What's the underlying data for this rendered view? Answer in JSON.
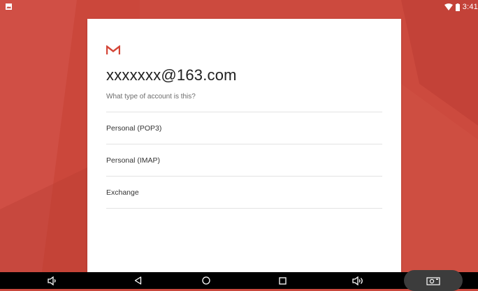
{
  "status_bar": {
    "time": "3:41",
    "left_icon": "image-notification-icon",
    "wifi_icon": "wifi-icon",
    "battery_icon": "battery-icon"
  },
  "card": {
    "logo": "gmail-logo",
    "email": "xxxxxxx@163.com",
    "subtitle": "What type of account is this?",
    "options": [
      {
        "label": "Personal (POP3)"
      },
      {
        "label": "Personal (IMAP)"
      },
      {
        "label": "Exchange"
      }
    ]
  },
  "nav_bar": {
    "buttons": [
      {
        "name": "volume-down-icon"
      },
      {
        "name": "back-icon"
      },
      {
        "name": "home-icon"
      },
      {
        "name": "recents-icon"
      },
      {
        "name": "volume-up-icon"
      },
      {
        "name": "screenshot-icon"
      }
    ]
  },
  "colors": {
    "background": "#cc4a3e",
    "card": "#ffffff",
    "gmail_red": "#d44638",
    "nav_bar": "#000000"
  }
}
